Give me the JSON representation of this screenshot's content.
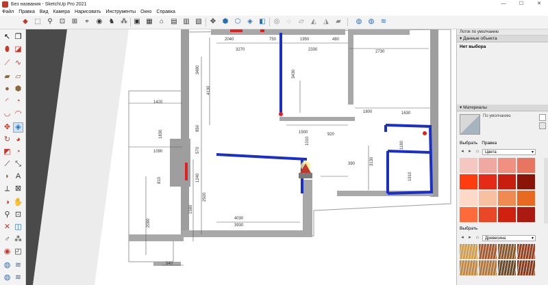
{
  "window": {
    "title": "Без названия - SketchUp Pro 2021",
    "min": "—",
    "max": "☐",
    "close": "✕"
  },
  "menu": [
    "Файл",
    "Правка",
    "Вид",
    "Камера",
    "Нарисовать",
    "Инструменты",
    "Окно",
    "Справка"
  ],
  "toolbar_icons": [
    "paint-bucket-icon",
    "zoom-extents-icon",
    "zoom-icon",
    "zoom-window-icon",
    "previous-view-icon",
    "walk-icon",
    "look-around-icon",
    "position-camera-icon",
    "select-icon",
    "section-plane-icon",
    "eraser-icon",
    "move-icon",
    "rotate-icon",
    "scale-icon",
    "offset-icon",
    "orbit-icon",
    "component-icon",
    "warehouse-icon",
    "home-icon",
    "extension-icon",
    "export-icon",
    "styles-icon",
    "iso-view-icon",
    "top-view-icon",
    "front-view-icon",
    "right-view-icon",
    "back-view-icon",
    "left-view-icon",
    "xray-icon",
    "wireframe-icon",
    "hidden-line-icon",
    "shaded-icon",
    "textured-icon",
    "monochrome-icon",
    "hide-rest-icon",
    "section-cut-icon",
    "fog-icon"
  ],
  "viewport_dims": {
    "d2040": "2040",
    "d750": "750",
    "d1950": "1950",
    "d480": "480",
    "d3270": "3270",
    "d2330": "2330",
    "d2730": "2730",
    "d3480": "3480",
    "d4130": "4130",
    "d3430": "3430",
    "d1420": "1420",
    "d1800": "1800",
    "d1630": "1630",
    "d1830": "1830",
    "d850": "850",
    "d1500": "1500",
    "d920": "920",
    "d1010": "1010",
    "d570": "570",
    "d1090": "1090",
    "d3130": "3130",
    "d1240": "1240",
    "d390": "390",
    "d810": "810",
    "d1910": "1910",
    "d1180": "1180",
    "d2920": "2920",
    "d1580": "1580",
    "d2090": "2090",
    "d4030": "4030",
    "d3930": "3930",
    "d540": "540"
  },
  "panel": {
    "tray_title": "Лоток по умолчанию",
    "entity_info": {
      "header": "Данные объекта",
      "selection": "Нет выбора"
    },
    "materials": {
      "header": "Материалы",
      "default_name": "По умолчанию",
      "tab_select": "Выбрать",
      "tab_edit": "Правка",
      "colors_collection": "Цвета",
      "select_label2": "Выбрать",
      "wood_collection": "Древесина"
    },
    "color_swatches": [
      "#f4c7c0",
      "#f0a9a0",
      "#ef9080",
      "#e8755f",
      "#ff3b10",
      "#e52a18",
      "#c81e10",
      "#8a1408",
      "#ffd9c8",
      "#f7c0a0",
      "#f08a50",
      "#e86a20",
      "#ff6a3a",
      "#e84828",
      "#d02010",
      "#aa1a10"
    ],
    "wood_swatches": [
      "#d6a04a",
      "#a8582a",
      "#8c5a2a",
      "#9a3f1c",
      "#c58a40",
      "#b57838",
      "#6a4a28",
      "#8a3a18"
    ]
  }
}
